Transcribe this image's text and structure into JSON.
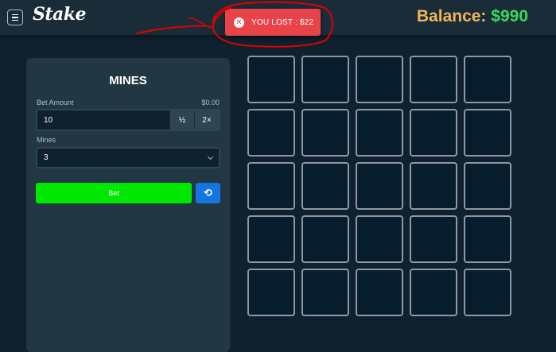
{
  "header": {
    "logo": "Stake",
    "toast": {
      "icon": "close-circle-icon",
      "text": "YOU LOST : $22"
    },
    "balance_label": "Balance:",
    "balance_value": "$990"
  },
  "panel": {
    "title": "MINES",
    "bet_amount_label": "Bet Amount",
    "bet_amount_usd": "$0.00",
    "bet_amount_value": "10",
    "half_label": "½",
    "double_label": "2×",
    "mines_label": "Mines",
    "mines_value": "3",
    "bet_button_label": "Bet",
    "reset_icon": "reset-icon"
  },
  "colors": {
    "background": "#0f212e",
    "topbar": "#1a2c38",
    "panel": "#213743",
    "toast": "#e9434a",
    "balance_label": "#f2b35d",
    "balance_value": "#3ad85d",
    "bet_button": "#00e701",
    "reset_button": "#1475e1",
    "tile": "#071d2e",
    "annotation": "#e00000"
  },
  "grid": {
    "rows": 5,
    "cols": 5
  }
}
